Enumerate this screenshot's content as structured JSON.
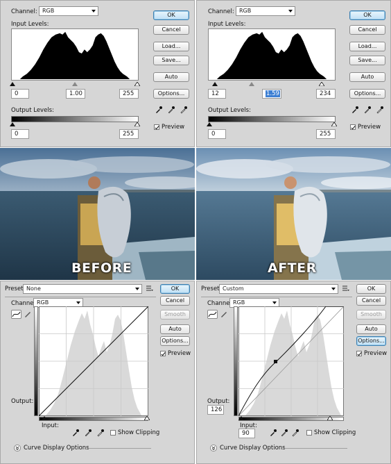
{
  "levels_before": {
    "channel_label": "Channel:",
    "channel_value": "RGB",
    "input_levels_label": "Input Levels:",
    "input_black": "0",
    "input_gamma": "1.00",
    "input_white": "255",
    "output_levels_label": "Output Levels:",
    "output_black": "0",
    "output_white": "255",
    "buttons": {
      "ok": "OK",
      "cancel": "Cancel",
      "load": "Load...",
      "save": "Save...",
      "auto": "Auto",
      "options": "Options..."
    },
    "preview_label": "Preview",
    "preview_checked": true
  },
  "levels_after": {
    "channel_label": "Channel:",
    "channel_value": "RGB",
    "input_levels_label": "Input Levels:",
    "input_black": "12",
    "input_gamma": "1.59",
    "input_white": "234",
    "output_levels_label": "Output Levels:",
    "output_black": "0",
    "output_white": "255",
    "buttons": {
      "ok": "OK",
      "cancel": "Cancel",
      "load": "Load...",
      "save": "Save...",
      "auto": "Auto",
      "options": "Options..."
    },
    "preview_label": "Preview",
    "preview_checked": true
  },
  "photos": {
    "before_caption": "BEFORE",
    "after_caption": "AFTER"
  },
  "curves_before": {
    "preset_label": "Preset:",
    "preset_value": "None",
    "channel_label": "Channel:",
    "channel_value": "RGB",
    "output_label": "Output:",
    "output_value": "",
    "input_label": "Input:",
    "input_value": "",
    "show_clipping_label": "Show Clipping",
    "curve_display_label": "Curve Display Options",
    "buttons": {
      "ok": "OK",
      "cancel": "Cancel",
      "smooth": "Smooth",
      "auto": "Auto",
      "options": "Options..."
    },
    "preview_label": "Preview",
    "preview_checked": true
  },
  "curves_after": {
    "preset_label": "Preset:",
    "preset_value": "Custom",
    "channel_label": "Channel:",
    "channel_value": "RGB",
    "output_label": "Output:",
    "output_value": "126",
    "input_label": "Input:",
    "input_value": "90",
    "show_clipping_label": "Show Clipping",
    "curve_display_label": "Curve Display Options",
    "buttons": {
      "ok": "OK",
      "cancel": "Cancel",
      "smooth": "Smooth",
      "auto": "Auto",
      "options": "Options..."
    },
    "preview_label": "Preview",
    "preview_checked": true
  },
  "colors": {
    "dialog_bg": "#d6d6d6",
    "default_button": "#bfe0f5",
    "selection": "#3d7fd3",
    "histogram_fill": "#000000",
    "curves_histogram_fill": "#d9d9d9"
  },
  "icons": [
    "eyedropper-black-icon",
    "eyedropper-gray-icon",
    "eyedropper-white-icon",
    "preset-menu-icon",
    "curve-point-icon",
    "pencil-icon",
    "expand-chevron-icon"
  ]
}
